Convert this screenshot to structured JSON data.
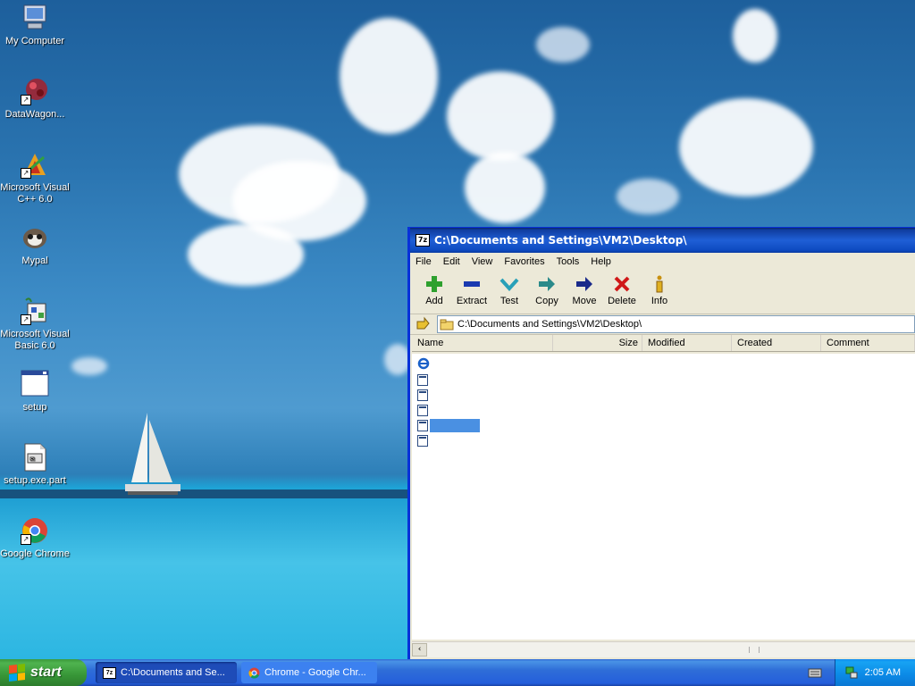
{
  "desktop": {
    "icons": [
      {
        "label": "My Computer",
        "icon": "my-computer-icon"
      },
      {
        "label": "DataWagon...",
        "icon": "datawagon-icon"
      },
      {
        "label": "Microsoft Visual C++ 6.0",
        "icon": "visual-cpp-icon"
      },
      {
        "label": "Mypal",
        "icon": "mypal-icon"
      },
      {
        "label": "Microsoft Visual Basic 6.0",
        "icon": "visual-basic-icon"
      },
      {
        "label": "setup",
        "icon": "setup-window-icon"
      },
      {
        "label": "setup.exe.part",
        "icon": "partial-file-icon"
      },
      {
        "label": "Google Chrome",
        "icon": "chrome-icon"
      }
    ]
  },
  "window": {
    "title": "C:\\Documents and Settings\\VM2\\Desktop\\",
    "badge": "7z",
    "menu": [
      "File",
      "Edit",
      "View",
      "Favorites",
      "Tools",
      "Help"
    ],
    "toolbar": [
      {
        "label": "Add",
        "icon": "add-plus-icon"
      },
      {
        "label": "Extract",
        "icon": "extract-minus-icon"
      },
      {
        "label": "Test",
        "icon": "test-check-icon"
      },
      {
        "label": "Copy",
        "icon": "copy-arrow-icon"
      },
      {
        "label": "Move",
        "icon": "move-arrow-icon"
      },
      {
        "label": "Delete",
        "icon": "delete-x-icon"
      },
      {
        "label": "Info",
        "icon": "info-icon"
      }
    ],
    "address": "C:\\Documents and Settings\\VM2\\Desktop\\",
    "columns": [
      "Name",
      "Size",
      "Modified",
      "Created",
      "Comment"
    ]
  },
  "taskbar": {
    "start_label": "start",
    "tasks": [
      {
        "label": "C:\\Documents and Se...",
        "icon": "7zip-icon"
      },
      {
        "label": "Chrome - Google Chr...",
        "icon": "chrome-icon"
      }
    ],
    "clock": "2:05 AM"
  },
  "colors": {
    "title_bar": "#0a3aa0",
    "taskbar": "#245edb",
    "start_button": "#379637",
    "selection": "#4a90e2"
  }
}
